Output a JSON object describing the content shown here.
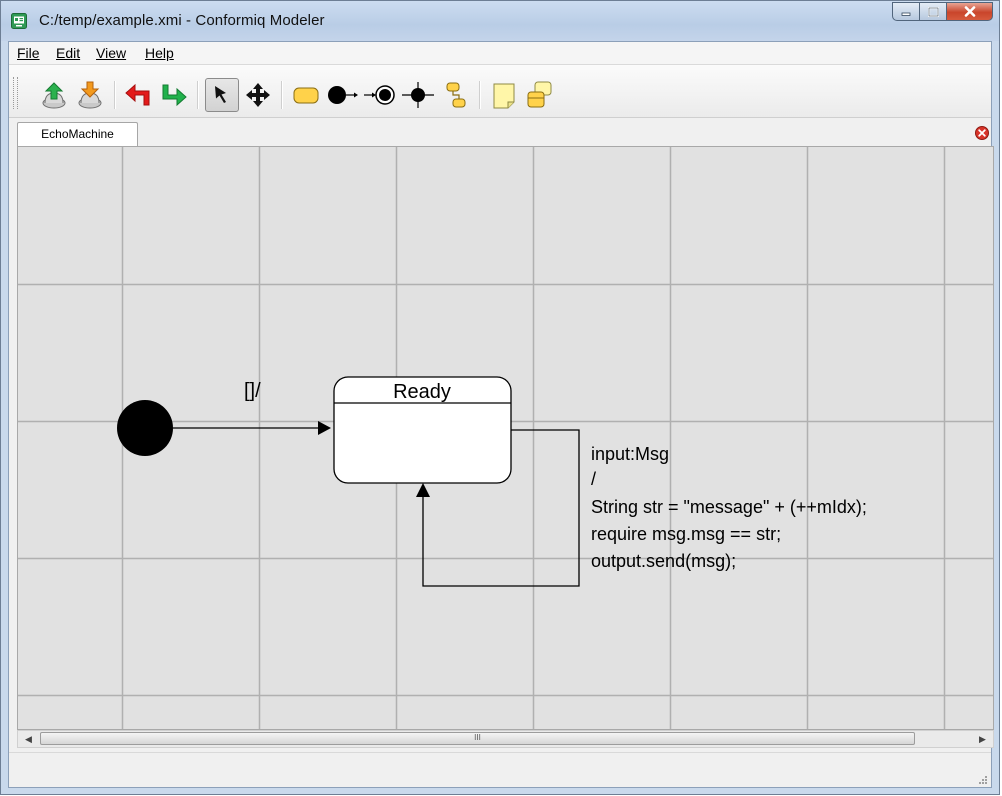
{
  "window": {
    "title": "C:/temp/example.xmi - Conformiq Modeler",
    "app_icon": "modeler-app-icon",
    "controls": [
      "minimize-icon",
      "maximize-icon",
      "close-icon"
    ]
  },
  "menu": {
    "items": [
      {
        "label": "File",
        "mnemonic": "F"
      },
      {
        "label": "Edit",
        "mnemonic": "E"
      },
      {
        "label": "View",
        "mnemonic": "V"
      },
      {
        "label": "Help",
        "mnemonic": "H"
      }
    ]
  },
  "toolbar": {
    "tools": [
      {
        "name": "export-icon",
        "active": false
      },
      {
        "name": "import-icon",
        "active": false
      },
      {
        "name": "undo-icon",
        "active": false
      },
      {
        "name": "redo-icon",
        "active": false
      },
      {
        "name": "select-pointer-icon",
        "active": true
      },
      {
        "name": "move-icon",
        "active": false
      },
      {
        "name": "state-icon",
        "active": false
      },
      {
        "name": "initial-state-icon",
        "active": false
      },
      {
        "name": "final-state-icon",
        "active": false
      },
      {
        "name": "junction-icon",
        "active": false
      },
      {
        "name": "composite-state-icon",
        "active": false
      },
      {
        "name": "note-icon",
        "active": false
      },
      {
        "name": "class-icon",
        "active": false
      }
    ]
  },
  "tabs": [
    {
      "label": "EchoMachine",
      "active": true
    }
  ],
  "diagram": {
    "state": {
      "name": "Ready"
    },
    "initial_transition": {
      "label": "[]/"
    },
    "self_transition": {
      "label_lines": [
        "input:Msg",
        "/",
        "String str = \"message\" + (++mIdx);",
        "require msg.msg == str;",
        "output.send(msg);"
      ]
    }
  },
  "scrollbar": {
    "thumb_grip": "III"
  },
  "colors": {
    "canvas": "#e1e1e1",
    "grid": "#b0b0b0",
    "state_fill": "#ffffff",
    "ink": "#000000",
    "undo": "#e31b1b",
    "redo": "#21b14c",
    "yellow": "#ffd24a"
  }
}
